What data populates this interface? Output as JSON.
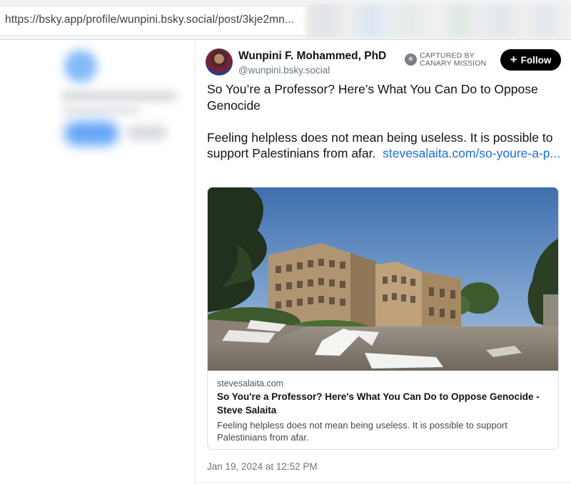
{
  "browser": {
    "url": "https://bsky.app/profile/wunpini.bsky.social/post/3kje2mn..."
  },
  "post": {
    "author_name": "Wunpini F. Mohammed, PhD",
    "author_handle": "@wunpini.bsky.social",
    "badge_line1": "CAPTURED BY",
    "badge_line2": "CANARY MISSION",
    "follow_label": "Follow",
    "text_line1": "So You’re a Professor? Here’s What You Can Do to Oppose Genocide",
    "text_line2": "Feeling helpless does not mean being useless. It is possible to support Palestinians from afar.",
    "link_text": "stevesalaita.com/so-youre-a-p...",
    "timestamp": "Jan 19, 2024 at 12:52 PM"
  },
  "card": {
    "domain": "stevesalaita.com",
    "title": "So You're a Professor? Here's What You Can Do to Oppose Genocide - Steve Salaita",
    "description": "Feeling helpless does not mean being useless. It is possible to support Palestinians from afar."
  },
  "icons": {
    "follow": "plus-icon",
    "badge": "canary-mission-icon"
  },
  "colors": {
    "link": "#1d6fd6",
    "follow_bg": "#000000",
    "muted": "#687684"
  }
}
